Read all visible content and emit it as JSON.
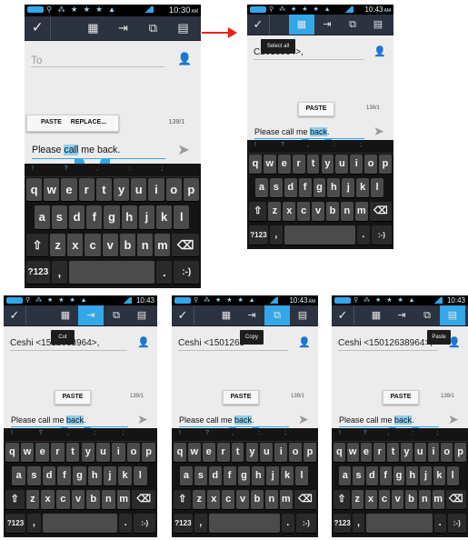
{
  "panels": [
    {
      "name": "panel-1",
      "time": "10:30",
      "ampm": "AM",
      "to_text": "To",
      "to_filled": false,
      "active_action": "",
      "counter": "139/1",
      "paste_label": "PASTE",
      "replace_label": "REPLACE...",
      "message_before": "Please ",
      "message_selected": "call",
      "message_after": " me back.",
      "tooltip": ""
    },
    {
      "name": "panel-2",
      "time": "10:43",
      "ampm": "AM",
      "to_text": "C2638964>,",
      "to_filled": true,
      "active_action": "select-all",
      "counter": "139/1",
      "paste_label": "PASTE",
      "replace_label": "",
      "message_before": "Please call me ",
      "message_selected": "back",
      "message_after": ".",
      "tooltip": "Select all"
    },
    {
      "name": "panel-3",
      "time": "10:43",
      "ampm": "",
      "to_text": "Ceshi <1512638964>,",
      "to_filled": true,
      "active_action": "cut",
      "counter": "139/1",
      "paste_label": "PASTE",
      "replace_label": "",
      "message_before": "Please call me ",
      "message_selected": "back",
      "message_after": ".",
      "tooltip": "Cut"
    },
    {
      "name": "panel-4",
      "time": "10:43",
      "ampm": "AM",
      "to_text": "Ceshi <1501263",
      "to_filled": true,
      "active_action": "copy",
      "counter": "139/1",
      "paste_label": "PASTE",
      "replace_label": "",
      "message_before": "Please call me ",
      "message_selected": "back",
      "message_after": ".",
      "tooltip": "Copy"
    },
    {
      "name": "panel-5",
      "time": "10:43",
      "ampm": "",
      "to_text": "Ceshi <15012638964>,",
      "to_filled": true,
      "active_action": "paste",
      "counter": "139/1",
      "paste_label": "PASTE",
      "replace_label": "",
      "message_before": "Please call me ",
      "message_selected": "back",
      "message_after": ".",
      "tooltip": "Paste"
    }
  ],
  "keyboard": {
    "suggestions": [
      "!",
      "?",
      ",",
      ":",
      ";"
    ],
    "row1": [
      "q",
      "w",
      "e",
      "r",
      "t",
      "y",
      "u",
      "i",
      "o",
      "p"
    ],
    "row2": [
      "a",
      "s",
      "d",
      "f",
      "g",
      "h",
      "j",
      "k",
      "l"
    ],
    "row3": [
      "z",
      "x",
      "c",
      "v",
      "b",
      "n",
      "m"
    ],
    "shift_icon": "⇧",
    "delete_icon": "⌫",
    "sym_label": "?123",
    "comma": ",",
    "period": ".",
    "smiley": ":-)"
  },
  "actions": {
    "done_icon": "check-icon",
    "select_all_icon": "select-all-icon",
    "cut_icon": "cut-icon",
    "copy_icon": "copy-icon",
    "paste_icon": "paste-icon"
  },
  "colors": {
    "accent": "#33a7e8",
    "action_bar": "#2b3240",
    "arrow": "#e8201a",
    "keyboard": "#141414",
    "key": "#4b4b4b"
  }
}
